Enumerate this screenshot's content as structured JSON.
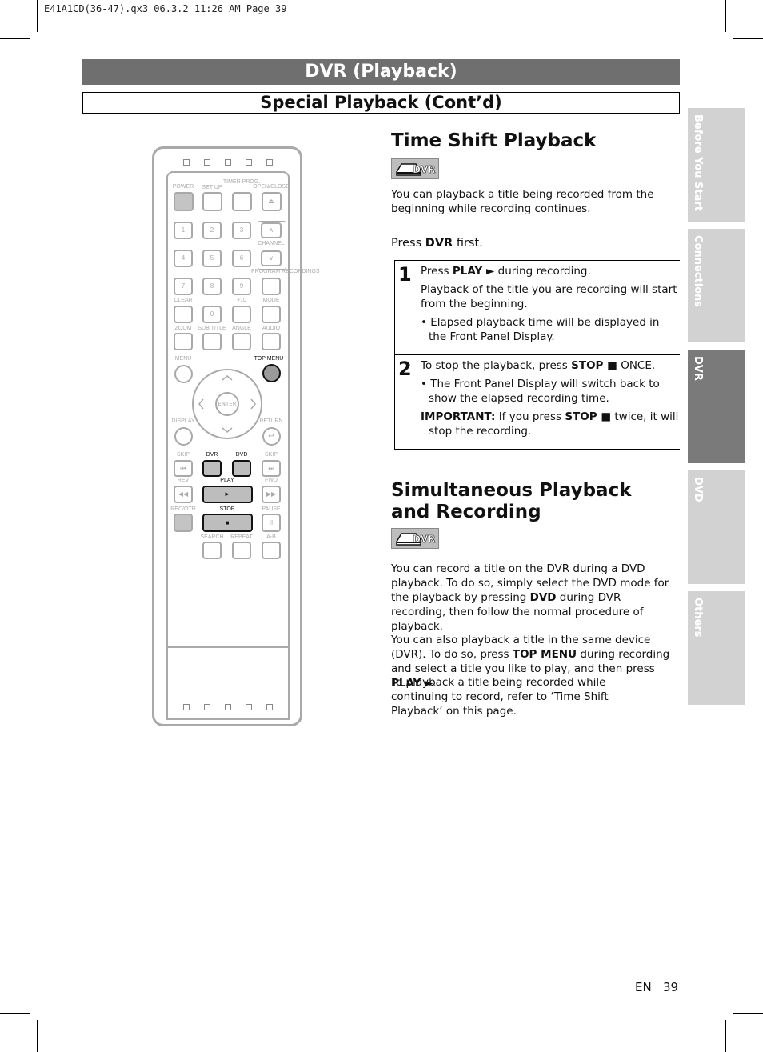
{
  "slug": "E41A1CD(36-47).qx3   06.3.2 11:26 AM   Page 39",
  "header": {
    "title": "DVR (Playback)",
    "subtitle": "Special Playback (Cont’d)"
  },
  "side_tabs": [
    {
      "label": "Before You Start",
      "active": false
    },
    {
      "label": "Connections",
      "active": false
    },
    {
      "label": "DVR",
      "active": true
    },
    {
      "label": "DVD",
      "active": false
    },
    {
      "label": "Others",
      "active": false
    }
  ],
  "badge": {
    "label": "DVR",
    "icon": "disc-drive-icon"
  },
  "time_shift": {
    "title": "Time Shift Playback",
    "intro": "You can playback a title being recorded from the beginning while recording continues.",
    "press_prefix": "Press ",
    "press_key": "DVR",
    "press_suffix": " first.",
    "step1": {
      "num": "1",
      "a": "Press ",
      "key": "PLAY ►",
      "b": " during recording.",
      "p2": "Playback of the title you are recording will start from the beginning.",
      "bullet": "• Elapsed playback time will be displayed in the Front Panel Display."
    },
    "step2": {
      "num": "2",
      "a": "To stop the playback, press ",
      "key": "STOP ■",
      "b": " ",
      "once": "ONCE",
      "c": ".",
      "bullet": "• The Front Panel Display will switch back to show the elapsed recording time.",
      "imp_label": "IMPORTANT:",
      "imp_a": " If you press ",
      "imp_key": "STOP ■",
      "imp_b": " twice, it will stop the recording."
    }
  },
  "simultaneous": {
    "title": "Simultaneous Playback and Recording",
    "p1a": "You can record a title on the DVR during a DVD playback. To do so, simply select the DVD mode for the playback by pressing ",
    "p1key": "DVD",
    "p1b": " during DVR recording, then follow the normal procedure of playback.",
    "p2a": "You can also playback a title in the same device (DVR). To do so, press ",
    "p2key": "TOP MENU",
    "p2b": " during recording and select a title you like to play, and then press ",
    "p2key2": "PLAY ►",
    "p2c": ".",
    "p3": "To playback a title being recorded while continuing to record, refer to ‘Time Shift Playback’ on this page."
  },
  "footer": {
    "lang": "EN",
    "page": "39"
  },
  "remote": {
    "labels": [
      "POWER",
      "SET UP",
      "TIMER PROG.",
      "OPEN/CLOSE",
      "CHANNEL",
      "PROGRAM RECORDINGS",
      "CLEAR",
      "+10",
      "MODE",
      "ZOOM",
      "SUB TITLE",
      "ANGLE",
      "AUDIO",
      "MENU",
      "TOP MENU",
      "DISPLAY",
      "RETURN",
      "SKIP",
      "DVR",
      "DVD",
      "SKIP",
      "REV",
      "PLAY",
      "FWD",
      "REC/OTR",
      "STOP",
      "PAUSE",
      "SEARCH",
      "REPEAT",
      "A-B",
      "ENTER"
    ],
    "keys": [
      "1",
      "2",
      "3",
      "4",
      "5",
      "6",
      "7",
      "8",
      "9",
      "0",
      "⏏",
      "∧",
      "∨",
      "⏮",
      "⏭",
      "◀◀",
      "▶▶",
      "►",
      "■",
      "II",
      "↵"
    ],
    "highlighted": [
      "DVR",
      "DVD",
      "PLAY",
      "STOP",
      "TOP MENU"
    ]
  }
}
